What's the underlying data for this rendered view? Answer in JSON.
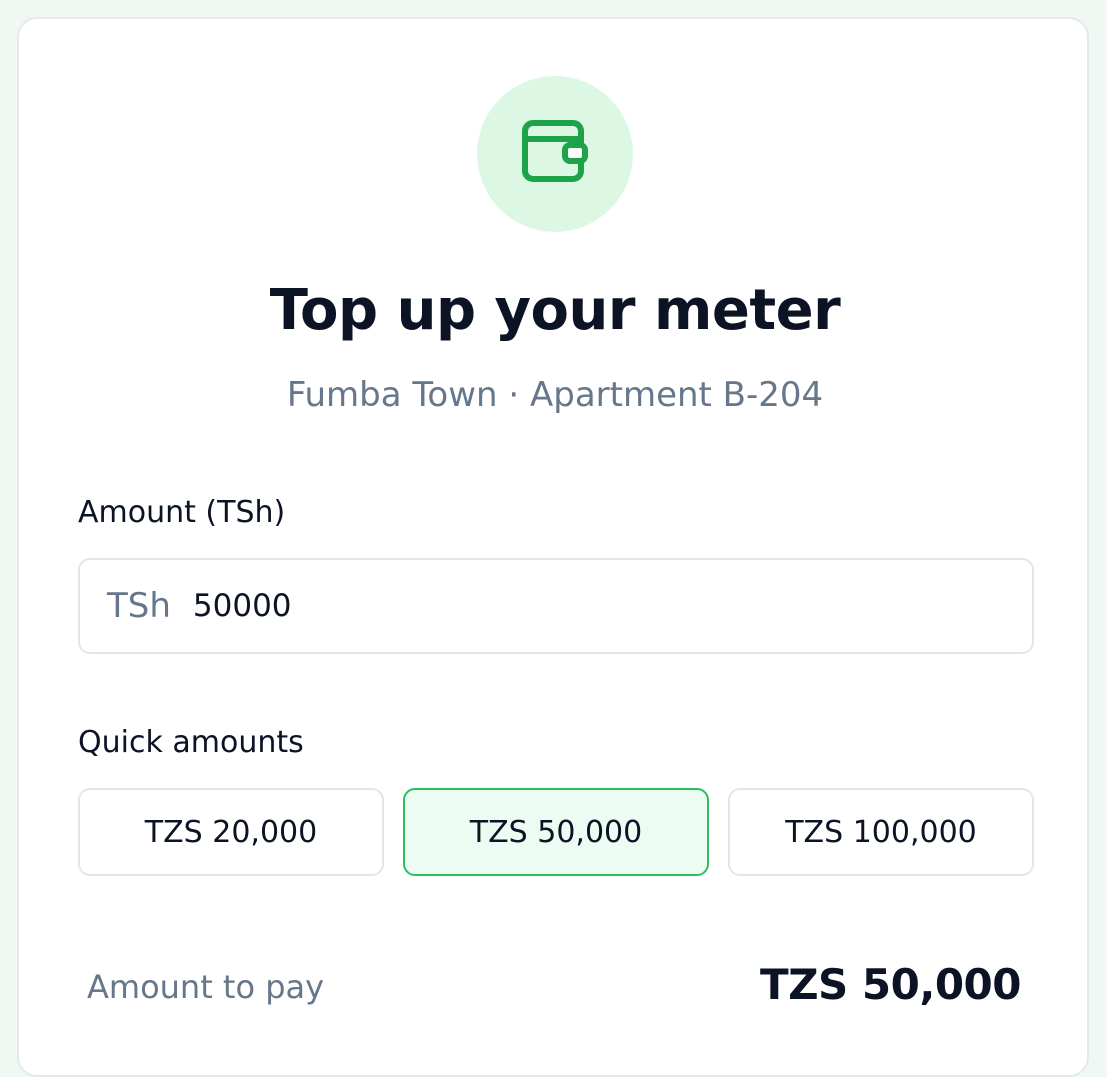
{
  "header": {
    "icon": "wallet-icon",
    "title": "Top up your meter",
    "subtitle": "Fumba Town · Apartment B-204"
  },
  "amount_field": {
    "label": "Amount (TSh)",
    "prefix": "TSh",
    "value": "50000"
  },
  "quick_amounts": {
    "label": "Quick amounts",
    "options": [
      {
        "label": "TZS 20,000",
        "selected": false
      },
      {
        "label": "TZS 50,000",
        "selected": true
      },
      {
        "label": "TZS 100,000",
        "selected": false
      }
    ]
  },
  "summary": {
    "label": "Amount to pay",
    "value": "TZS 50,000"
  },
  "colors": {
    "accent": "#1fa34a",
    "accent_bg": "#dcf8e5",
    "selected_border": "#2ebd66",
    "selected_bg": "#edfcf2",
    "muted_text": "#66778b",
    "heading_text": "#0b1324"
  }
}
